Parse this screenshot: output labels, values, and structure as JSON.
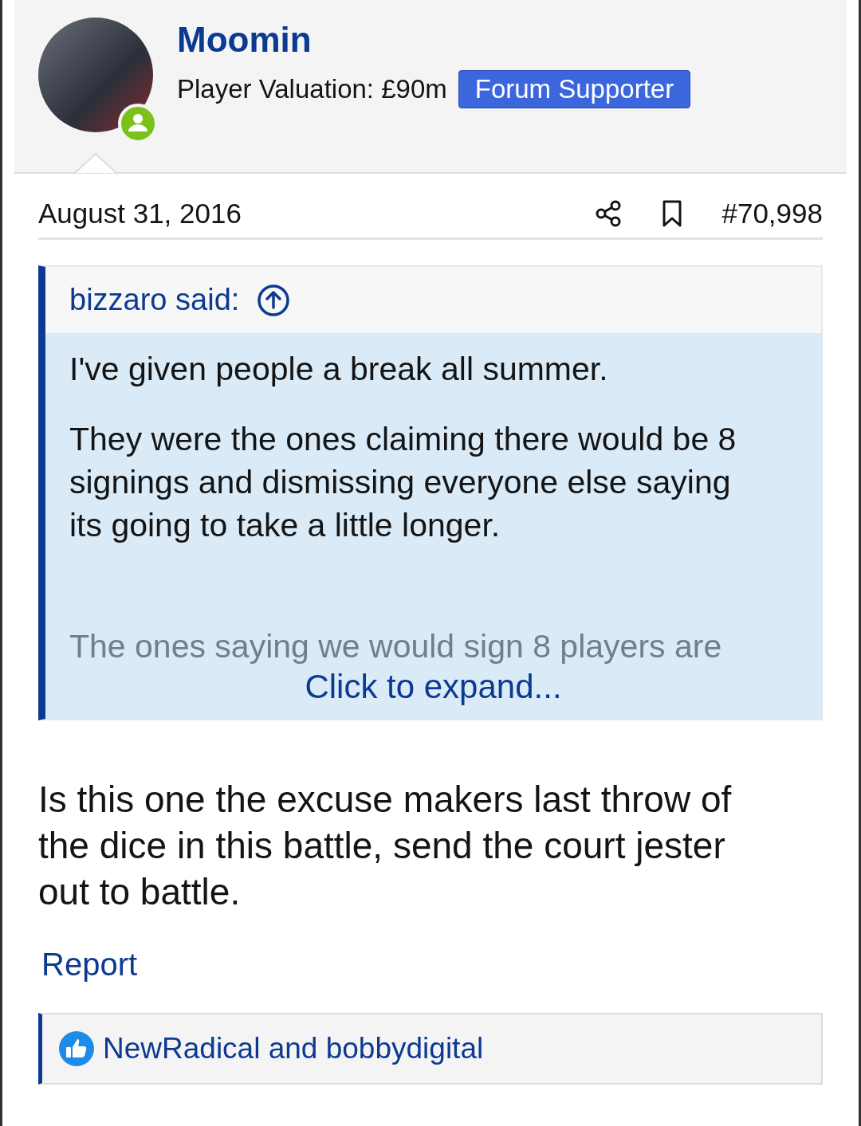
{
  "author": {
    "name": "Moomin",
    "valuation": "Player Valuation: £90m",
    "badge": "Forum Supporter",
    "online": true
  },
  "post": {
    "date": "August 31, 2016",
    "number": "#70,998"
  },
  "quote": {
    "attribution": "bizzaro said:",
    "paragraphs": [
      "I've given people a break all summer.",
      "They were the ones claiming there would be 8 signings and dismissing everyone else saying its going to take a little longer."
    ],
    "faded_line": "The ones saying we would sign 8 players are",
    "expand_link": "Click to expand..."
  },
  "body": "Is this one the excuse makers last throw of the dice in this battle, send the court jester out to battle.",
  "report_link": "Report",
  "reactions": {
    "text": "NewRadical and bobbydigital"
  }
}
